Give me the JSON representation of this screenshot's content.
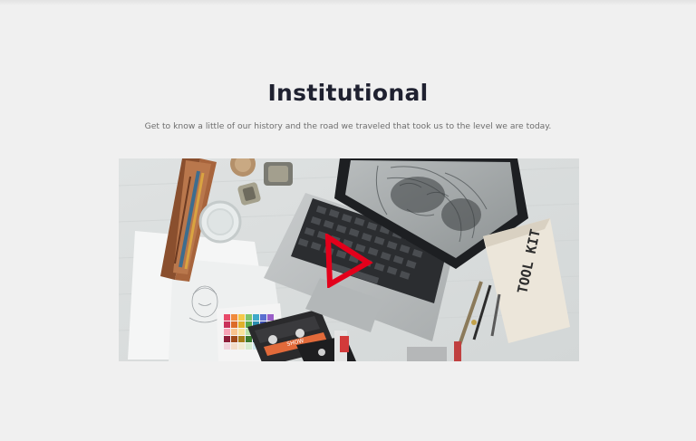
{
  "section": {
    "title": "Institutional",
    "subtitle": "Get to know a little of our history and the road we traveled that took us to the level we are today."
  },
  "video": {
    "toolkit_text": "TOOL KIT",
    "cassette_label": "SHOW",
    "play_icon": "play-triangle-outline",
    "play_color": "#e3001b"
  },
  "colors": {
    "background": "#f0f0f0",
    "title": "#1f2130",
    "subtitle": "#6e6e6e"
  }
}
